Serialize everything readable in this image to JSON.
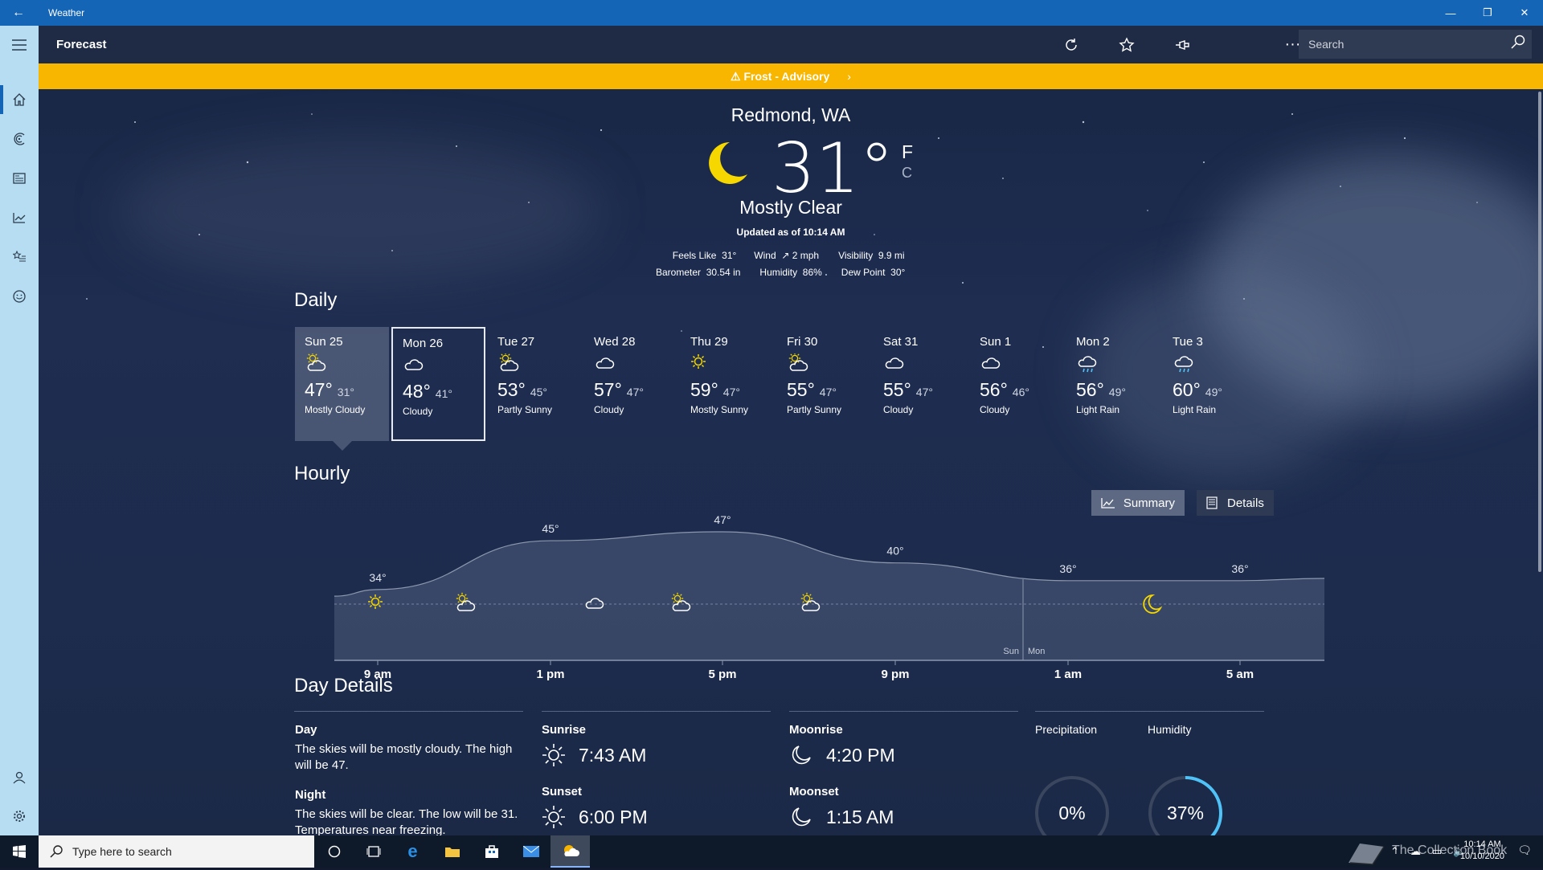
{
  "window": {
    "title": "Weather"
  },
  "header": {
    "page_title": "Forecast",
    "search_placeholder": "Search"
  },
  "alert": {
    "text": "⚠  Frost - Advisory"
  },
  "current": {
    "location": "Redmond, WA",
    "temp": "31°",
    "unit_f": "F",
    "unit_c": "C",
    "condition": "Mostly Clear",
    "updated": "Updated as of 10:14 AM",
    "metrics_row1": [
      {
        "label": "Feels Like",
        "value": "31°"
      },
      {
        "label": "Wind",
        "value": "↗ 2 mph"
      },
      {
        "label": "Visibility",
        "value": "9.9 mi"
      }
    ],
    "metrics_row2": [
      {
        "label": "Barometer",
        "value": "30.54 in"
      },
      {
        "label": "Humidity",
        "value": "86%"
      },
      {
        "label": "Dew Point",
        "value": "30°"
      }
    ]
  },
  "daily": {
    "title": "Daily",
    "days": [
      {
        "day": "Sun 25",
        "icon": "partly-cloudy-icon",
        "hi": "47°",
        "lo": "31°",
        "cond": "Mostly Cloudy"
      },
      {
        "day": "Mon 26",
        "icon": "cloudy-icon",
        "hi": "48°",
        "lo": "41°",
        "cond": "Cloudy"
      },
      {
        "day": "Tue 27",
        "icon": "partly-sunny-icon",
        "hi": "53°",
        "lo": "45°",
        "cond": "Partly Sunny"
      },
      {
        "day": "Wed 28",
        "icon": "cloudy-icon",
        "hi": "57°",
        "lo": "47°",
        "cond": "Cloudy"
      },
      {
        "day": "Thu 29",
        "icon": "sun-icon",
        "hi": "59°",
        "lo": "47°",
        "cond": "Mostly Sunny"
      },
      {
        "day": "Fri 30",
        "icon": "partly-sunny-icon",
        "hi": "55°",
        "lo": "47°",
        "cond": "Partly Sunny"
      },
      {
        "day": "Sat 31",
        "icon": "cloudy-icon",
        "hi": "55°",
        "lo": "47°",
        "cond": "Cloudy"
      },
      {
        "day": "Sun 1",
        "icon": "cloudy-icon",
        "hi": "56°",
        "lo": "46°",
        "cond": "Cloudy"
      },
      {
        "day": "Mon 2",
        "icon": "rain-icon",
        "hi": "56°",
        "lo": "49°",
        "cond": "Light Rain"
      },
      {
        "day": "Tue 3",
        "icon": "rain-icon",
        "hi": "60°",
        "lo": "49°",
        "cond": "Light Rain"
      }
    ]
  },
  "hourly": {
    "title": "Hourly",
    "summary_label": "Summary",
    "details_label": "Details",
    "time_labels": [
      "9 am",
      "1 pm",
      "5 pm",
      "9 pm",
      "1 am",
      "5 am"
    ],
    "day_divider": [
      "Sun",
      "Mon"
    ],
    "temp_labels": [
      "34°",
      "45°",
      "47°",
      "40°",
      "36°",
      "36°"
    ]
  },
  "chart_data": {
    "type": "area",
    "x": [
      "9 am",
      "1 pm",
      "5 pm",
      "9 pm",
      "1 am",
      "5 am"
    ],
    "series": [
      {
        "values": [
          34,
          45,
          47,
          40,
          36,
          36
        ]
      }
    ]
  },
  "day_details": {
    "title": "Day Details",
    "day_label": "Day",
    "day_text": "The skies will be mostly cloudy. The high will be 47.",
    "night_label": "Night",
    "night_text": "The skies will be clear. The low will be 31. Temperatures near freezing.",
    "sunrise_label": "Sunrise",
    "sunrise": "7:43 AM",
    "sunset_label": "Sunset",
    "sunset": "6:00 PM",
    "moonrise_label": "Moonrise",
    "moonrise": "4:20 PM",
    "moonset_label": "Moonset",
    "moonset": "1:15 AM",
    "precip_label": "Precipitation",
    "precip": "0%",
    "precip_value": 0,
    "humidity_label": "Humidity",
    "humidity": "37%",
    "humidity_value": 37
  },
  "taskbar": {
    "search_placeholder": "Type here to search",
    "time": "10:14 AM",
    "date": "10/10/2020",
    "watermark": "The Collection Book"
  },
  "colors": {
    "accent": "#1565b6",
    "alert": "#f8b600",
    "rail": "#b7ddf3",
    "ring": "#4fc3f7"
  }
}
